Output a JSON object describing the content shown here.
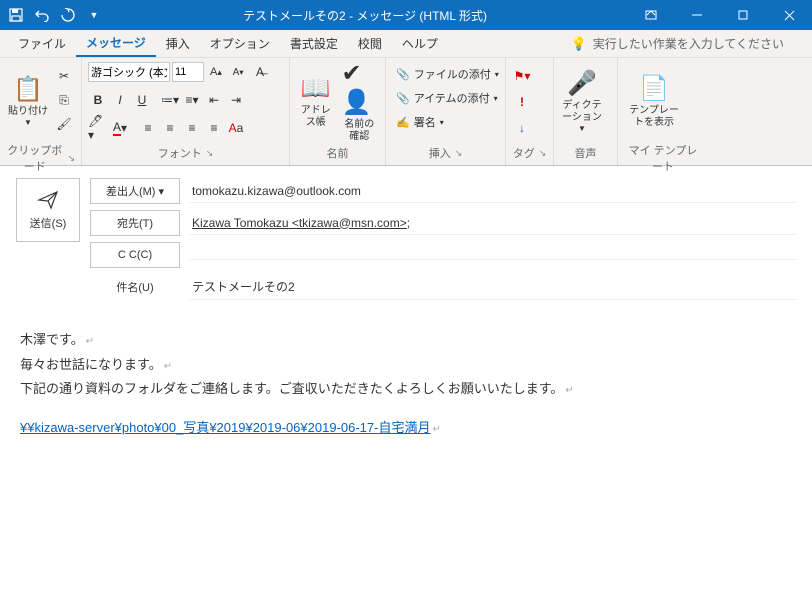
{
  "titlebar": {
    "title": "テストメールその2 - メッセージ (HTML 形式)",
    "qat": {
      "save": "💾",
      "undo": "↶",
      "redo": "↻"
    }
  },
  "menubar": {
    "tabs": [
      "ファイル",
      "メッセージ",
      "挿入",
      "オプション",
      "書式設定",
      "校閲",
      "ヘルプ"
    ],
    "active": 1,
    "search_placeholder": "実行したい作業を入力してください"
  },
  "ribbon": {
    "clipboard": {
      "paste": "貼り付け",
      "label": "クリップボード"
    },
    "font": {
      "name": "游ゴシック (本文の",
      "size": "11",
      "label": "フォント"
    },
    "names": {
      "addressbook": "アドレス帳",
      "checknames": "名前の\n確認",
      "label": "名前"
    },
    "insert": {
      "attach_file": "ファイルの添付",
      "attach_item": "アイテムの添付",
      "signature": "署名",
      "label": "挿入"
    },
    "tags": {
      "label": "タグ"
    },
    "voice": {
      "dictation": "ディクテ\nーション",
      "label": "音声"
    },
    "templates": {
      "show": "テンプレー\nトを表示",
      "label": "マイ テンプレート"
    }
  },
  "fields": {
    "send": "送信(S)",
    "from_label": "差出人(M)",
    "from_value": "tomokazu.kizawa@outlook.com",
    "to_label": "宛先(T)",
    "to_value": "Kizawa Tomokazu <tkizawa@msn.com>;",
    "cc_label": "C C(C)",
    "cc_value": "",
    "subject_label": "件名(U)",
    "subject_value": "テストメールその2"
  },
  "body": {
    "p1": "木澤です。",
    "p2": "毎々お世話になります。",
    "p3": "下記の通り資料のフォルダをご連絡します。ご査収いただきたくよろしくお願いいたします。",
    "link": "¥¥kizawa-server¥photo¥00_写真¥2019¥2019-06¥2019-06-17-自宅満月"
  }
}
